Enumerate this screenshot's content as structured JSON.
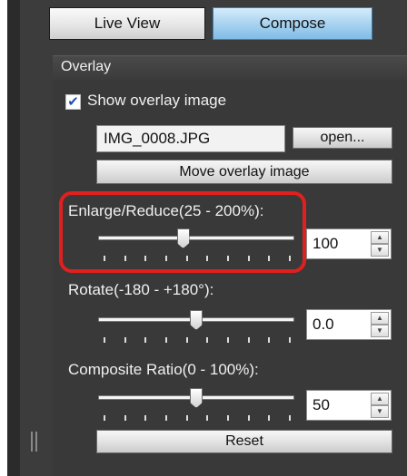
{
  "tabs": {
    "live_view": "Live View",
    "compose": "Compose"
  },
  "overlay": {
    "header": "Overlay",
    "show_overlay_label": "Show overlay image",
    "show_overlay_checked": true,
    "file_name": "IMG_0008.JPG",
    "open_label": "open...",
    "move_label": "Move overlay image"
  },
  "enlarge": {
    "label": "Enlarge/Reduce(25 - 200%):",
    "value": "100",
    "min": 25,
    "max": 200,
    "level": 100
  },
  "rotate": {
    "label": "Rotate(-180 - +180°):",
    "value": "0.0",
    "min": -180,
    "max": 180,
    "level": 0
  },
  "ratio": {
    "label": "Composite Ratio(0 - 100%):",
    "value": "50",
    "min": 0,
    "max": 100,
    "level": 50
  },
  "reset_label": "Reset",
  "colors": {
    "highlight": "#e0201f",
    "compose_tab": "#a9d3f0",
    "checkmark": "#1e4fb8"
  }
}
